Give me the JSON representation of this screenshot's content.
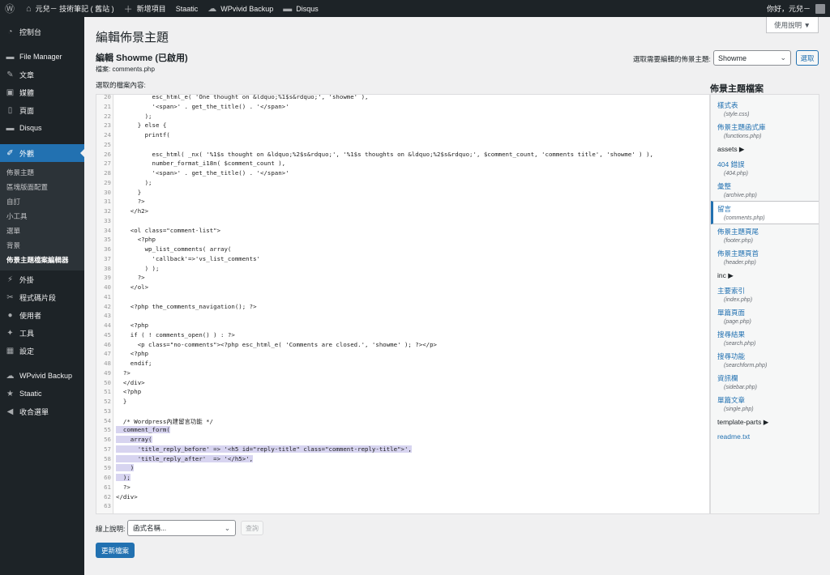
{
  "adminbar": {
    "wp_logo": "wordpress-icon",
    "site_name": "元兒－ 技術筆記 ( 舊站 )",
    "new_item": "新增項目",
    "staatic": "Staatic",
    "wpvivid": "WPvivid Backup",
    "disqus": "Disqus",
    "greeting": "你好，元兒－"
  },
  "sidebar": {
    "items": [
      {
        "label": "控制台",
        "icon": "dashboard-icon"
      },
      {
        "label": "File Manager",
        "icon": "folder-icon"
      },
      {
        "label": "文章",
        "icon": "pin-icon"
      },
      {
        "label": "媒體",
        "icon": "media-icon"
      },
      {
        "label": "頁面",
        "icon": "page-icon"
      },
      {
        "label": "Disqus",
        "icon": "comment-icon"
      },
      {
        "label": "外觀",
        "icon": "brush-icon"
      }
    ],
    "submenu": [
      "佈景主題",
      "區塊版面配置",
      "自訂",
      "小工具",
      "選單",
      "背景",
      "佈景主題檔案編輯器"
    ],
    "items2": [
      {
        "label": "外掛",
        "icon": "plugin-icon"
      },
      {
        "label": "程式碼片段",
        "icon": "snippets-icon"
      },
      {
        "label": "使用者",
        "icon": "user-icon"
      },
      {
        "label": "工具",
        "icon": "wrench-icon"
      },
      {
        "label": "設定",
        "icon": "settings-icon"
      },
      {
        "label": "WPvivid Backup",
        "icon": "cloud-icon"
      },
      {
        "label": "Staatic",
        "icon": "star-icon"
      },
      {
        "label": "收合選單",
        "icon": "collapse-icon"
      }
    ]
  },
  "main": {
    "page_title": "編輯佈景主題",
    "help_label": "使用說明 ▼",
    "subtitle": "編輯 Showme (已啟用)",
    "file_label": "檔案: comments.php",
    "select_theme_label": "選取需要編輯的佈景主題:",
    "theme_value": "Showme",
    "select_button": "選取",
    "selected_content_label": "選取的檔案內容:",
    "theme_files_heading": "佈景主題檔案",
    "doc_label": "線上說明:",
    "doc_placeholder": "函式名稱...",
    "lookup_button": "查詢",
    "update_button": "更新檔案"
  },
  "files": [
    {
      "title": "樣式表",
      "name": "(style.css)"
    },
    {
      "title": "佈景主題函式庫",
      "name": "(functions.php)"
    },
    {
      "folder": "assets ▶"
    },
    {
      "title": "404 錯誤",
      "name": "(404.php)"
    },
    {
      "title": "彙整",
      "name": "(archive.php)"
    },
    {
      "title": "留言",
      "name": "(comments.php)",
      "current": true
    },
    {
      "title": "佈景主題頁尾",
      "name": "(footer.php)"
    },
    {
      "title": "佈景主題頁首",
      "name": "(header.php)"
    },
    {
      "folder": "inc ▶"
    },
    {
      "title": "主要索引",
      "name": "(index.php)"
    },
    {
      "title": "單篇頁面",
      "name": "(page.php)"
    },
    {
      "title": "搜尋結果",
      "name": "(search.php)"
    },
    {
      "title": "搜尋功能",
      "name": "(searchform.php)"
    },
    {
      "title": "資訊欄",
      "name": "(sidebar.php)"
    },
    {
      "title": "單篇文章",
      "name": "(single.php)"
    },
    {
      "folder": "template-parts ▶"
    },
    {
      "link": "readme.txt"
    }
  ],
  "code": [
    {
      "n": "20",
      "t": "          esc_html_e( 'One thought on &ldquo;%1$s&rdquo;', 'showme' ),"
    },
    {
      "n": "21",
      "t": "          '<span>' . get_the_title() . '</span>'"
    },
    {
      "n": "22",
      "t": "        );"
    },
    {
      "n": "23",
      "t": "      } else {"
    },
    {
      "n": "24",
      "t": "        printf("
    },
    {
      "n": "25",
      "t": ""
    },
    {
      "n": "26",
      "t": "          esc_html( _nx( '%1$s thought on &ldquo;%2$s&rdquo;', '%1$s thoughts on &ldquo;%2$s&rdquo;', $comment_count, 'comments title', 'showme' ) ),"
    },
    {
      "n": "27",
      "t": "          number_format_i18n( $comment_count ),"
    },
    {
      "n": "28",
      "t": "          '<span>' . get_the_title() . '</span>'"
    },
    {
      "n": "29",
      "t": "        );"
    },
    {
      "n": "30",
      "t": "      }"
    },
    {
      "n": "31",
      "t": "      ?>"
    },
    {
      "n": "32",
      "t": "    </h2>"
    },
    {
      "n": "33",
      "t": ""
    },
    {
      "n": "34",
      "t": "    <ol class=\"comment-list\">"
    },
    {
      "n": "35",
      "t": "      <?php"
    },
    {
      "n": "36",
      "t": "        wp_list_comments( array("
    },
    {
      "n": "37",
      "t": "          'callback'=>'vs_list_comments'"
    },
    {
      "n": "38",
      "t": "        ) );"
    },
    {
      "n": "39",
      "t": "      ?>"
    },
    {
      "n": "40",
      "t": "    </ol>"
    },
    {
      "n": "41",
      "t": ""
    },
    {
      "n": "42",
      "t": "    <?php the_comments_navigation(); ?>"
    },
    {
      "n": "43",
      "t": ""
    },
    {
      "n": "44",
      "t": "    <?php"
    },
    {
      "n": "45",
      "t": "    if ( ! comments_open() ) : ?>"
    },
    {
      "n": "46",
      "t": "      <p class=\"no-comments\"><?php esc_html_e( 'Comments are closed.', 'showme' ); ?></p>"
    },
    {
      "n": "47",
      "t": "    <?php"
    },
    {
      "n": "48",
      "t": "    endif;"
    },
    {
      "n": "49",
      "t": "  ?>"
    },
    {
      "n": "50",
      "t": "  </div>"
    },
    {
      "n": "51",
      "t": "  <?php"
    },
    {
      "n": "52",
      "t": "  }"
    },
    {
      "n": "53",
      "t": ""
    },
    {
      "n": "54",
      "t": "  /* Wordpress內建留言功能 */"
    },
    {
      "n": "55",
      "t": "  comment_form(",
      "hl": true
    },
    {
      "n": "56",
      "t": "    array(",
      "hl": true
    },
    {
      "n": "57",
      "t": "      'title_reply_before' => '<h5 id=\"reply-title\" class=\"comment-reply-title\">',",
      "hl": true
    },
    {
      "n": "58",
      "t": "      'title_reply_after'  => '</h5>',",
      "hl": true
    },
    {
      "n": "59",
      "t": "    )",
      "hl": true
    },
    {
      "n": "60",
      "t": "  );",
      "hl": true
    },
    {
      "n": "61",
      "t": "  ?>"
    },
    {
      "n": "62",
      "t": "</div>"
    },
    {
      "n": "63",
      "t": ""
    }
  ],
  "colors": {
    "accent": "#2271b1",
    "adminbar": "#1d2327",
    "highlight": "#d7d4f0"
  }
}
